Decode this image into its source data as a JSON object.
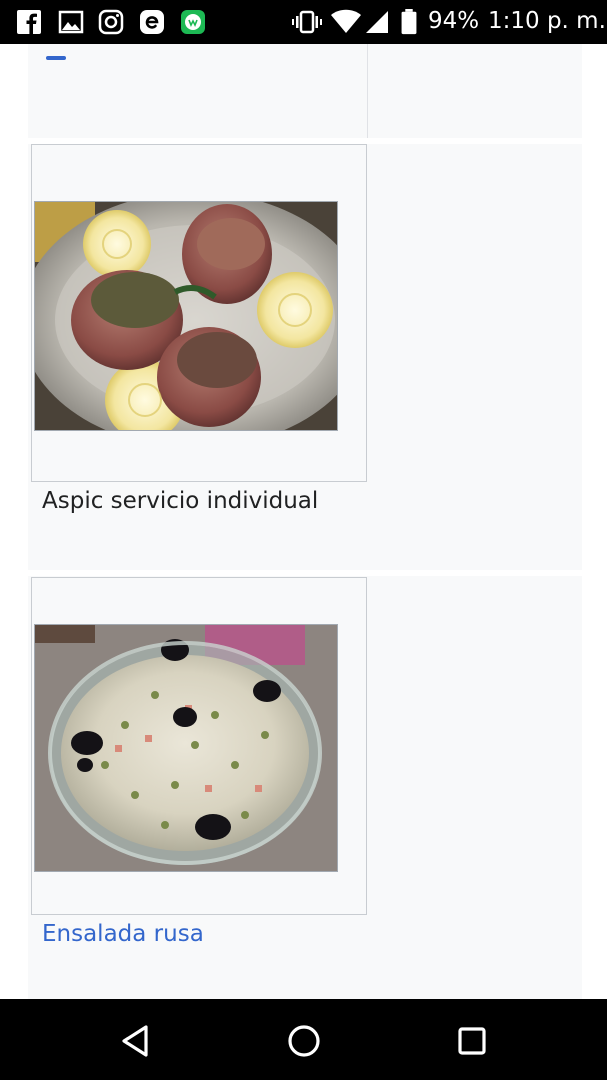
{
  "status_bar": {
    "battery_percent": "94%",
    "time": "1:10 p. m.",
    "notification_icons": [
      "facebook-icon",
      "gallery-icon",
      "instagram-icon",
      "app-e-icon",
      "wechat-like-icon"
    ],
    "system_icons": [
      "vibrate-icon",
      "wifi-icon",
      "signal-icon",
      "battery-icon"
    ]
  },
  "gallery": {
    "items": [
      {
        "caption": "Aspic servicio individual",
        "is_link": false,
        "image": "aspic-plate-photo"
      },
      {
        "caption": "Ensalada rusa",
        "is_link": true,
        "image": "russian-salad-photo"
      }
    ]
  },
  "nav_bar": {
    "buttons": [
      "back-icon",
      "home-icon",
      "recents-icon"
    ]
  },
  "colors": {
    "link": "#3366cc",
    "text": "#202122",
    "gallery_bg": "#f8f9fa",
    "border": "#c8ccd1"
  }
}
